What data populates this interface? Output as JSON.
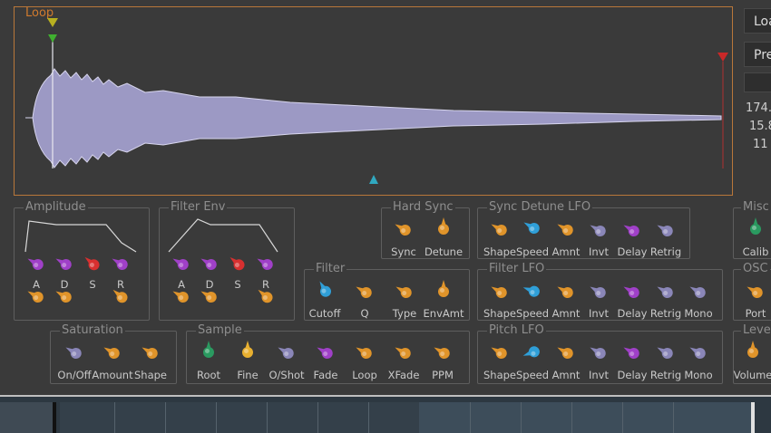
{
  "loop": {
    "title": "Loop"
  },
  "side": {
    "load_label": "Loa",
    "preset_label": "Pre",
    "values": [
      "174.",
      "15.8",
      "11"
    ]
  },
  "amplitude": {
    "title": "Amplitude",
    "labels": [
      "A",
      "D",
      "S",
      "R"
    ]
  },
  "filter_env": {
    "title": "Filter Env",
    "labels": [
      "A",
      "D",
      "S",
      "R"
    ]
  },
  "hard_sync": {
    "title": "Hard Sync",
    "labels": [
      "Sync",
      "Detune"
    ]
  },
  "sync_detune_lfo": {
    "title": "Sync Detune LFO",
    "labels": [
      "Shape",
      "Speed",
      "Amnt",
      "Invt",
      "Delay",
      "Retrig"
    ]
  },
  "misc": {
    "title": "Misc",
    "labels": [
      "Calib"
    ]
  },
  "filter": {
    "title": "Filter",
    "labels": [
      "Cutoff",
      "Q",
      "Type",
      "EnvAmt"
    ]
  },
  "filter_lfo": {
    "title": "Filter LFO",
    "labels": [
      "Shape",
      "Speed",
      "Amnt",
      "Invt",
      "Delay",
      "Retrig",
      "Mono"
    ]
  },
  "osc": {
    "title": "OSC",
    "labels": [
      "Port"
    ]
  },
  "saturation": {
    "title": "Saturation",
    "labels": [
      "On/Off",
      "Amount",
      "Shape"
    ]
  },
  "sample": {
    "title": "Sample",
    "labels": [
      "Root",
      "Fine",
      "O/Shot",
      "Fade",
      "Loop",
      "XFade",
      "PPM"
    ]
  },
  "pitch_lfo": {
    "title": "Pitch LFO",
    "labels": [
      "Shape",
      "Speed",
      "Amnt",
      "Invt",
      "Delay",
      "Retrig",
      "Mono"
    ]
  },
  "level": {
    "title": "Leve",
    "labels": [
      "Volume"
    ]
  },
  "colors": {
    "orange": "#e0942a",
    "blue": "#2f9fd8",
    "purple": "#a040c8",
    "red": "#d83030",
    "grey": "#8a86b8",
    "green": "#2a9a60",
    "yellow": "#e8b030"
  }
}
